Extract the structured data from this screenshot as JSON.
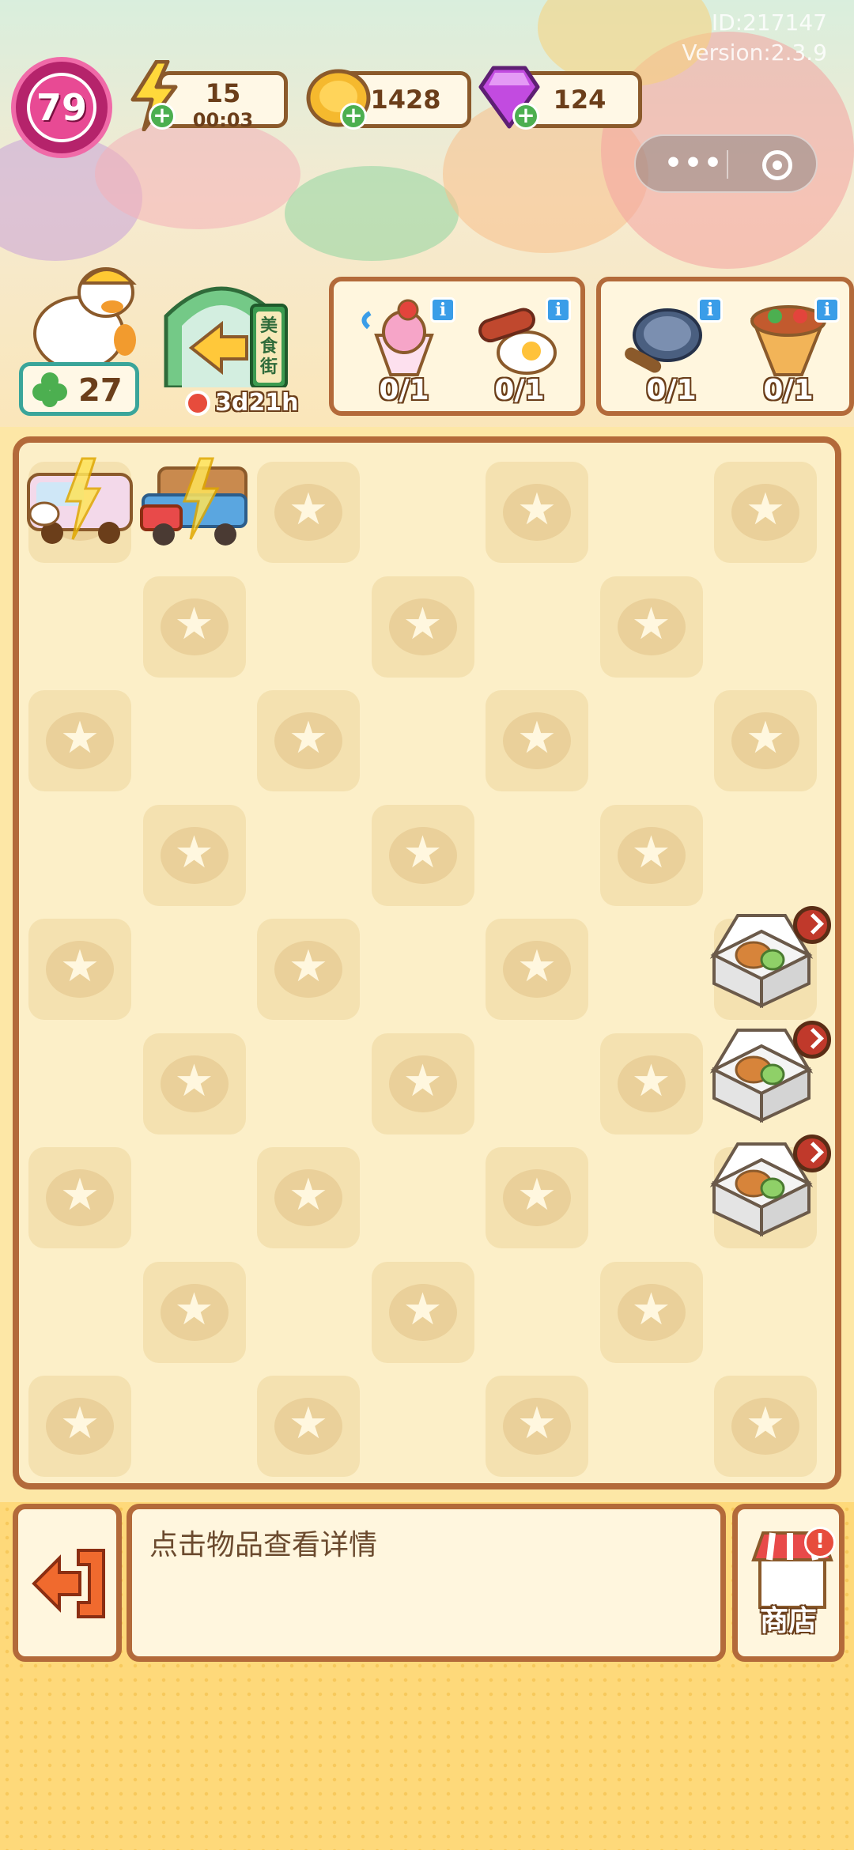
{
  "header": {
    "id_text": "ID:217147",
    "version_text": "Version:2.3.9"
  },
  "player": {
    "level": "79",
    "clover_count": "27"
  },
  "resources": {
    "energy": {
      "value": "15",
      "timer": "00:03",
      "icon": "lightning-icon"
    },
    "coins": {
      "value": "1428",
      "icon": "coin-icon"
    },
    "gems": {
      "value": "124",
      "icon": "gem-icon"
    }
  },
  "event": {
    "sign_text": "美食街",
    "timer": "3d21h"
  },
  "orders": [
    {
      "items": [
        {
          "icon": "ice-cream-dessert-icon",
          "count": "0/1"
        },
        {
          "icon": "fried-egg-sausage-icon",
          "count": "0/1"
        }
      ]
    },
    {
      "items": [
        {
          "icon": "frying-pan-icon",
          "count": "0/1"
        },
        {
          "icon": "wrap-roll-icon",
          "count": "0/1"
        }
      ]
    }
  ],
  "board": {
    "columns": 7,
    "rows": 9,
    "star_pattern": [
      [
        1,
        0,
        1,
        0,
        1,
        0,
        1
      ],
      [
        0,
        1,
        0,
        1,
        0,
        1,
        0
      ],
      [
        1,
        0,
        1,
        0,
        1,
        0,
        1
      ],
      [
        0,
        1,
        0,
        1,
        0,
        1,
        0
      ],
      [
        1,
        0,
        1,
        0,
        1,
        0,
        1
      ],
      [
        0,
        1,
        0,
        1,
        0,
        1,
        0
      ],
      [
        1,
        0,
        1,
        0,
        1,
        0,
        1
      ],
      [
        0,
        1,
        0,
        1,
        0,
        1,
        0
      ],
      [
        1,
        0,
        1,
        0,
        1,
        0,
        1
      ]
    ],
    "items": [
      {
        "name": "ice-cream-truck",
        "row": 0,
        "col": 0
      },
      {
        "name": "delivery-truck",
        "row": 0,
        "col": 1
      },
      {
        "name": "food-box",
        "row": 4,
        "col": 6,
        "timer": true
      },
      {
        "name": "food-box",
        "row": 5,
        "col": 6,
        "timer": true
      },
      {
        "name": "food-box",
        "row": 6,
        "col": 6,
        "timer": true
      }
    ]
  },
  "bottom": {
    "info_text": "点击物品查看详情",
    "shop_label": "商店",
    "shop_alert": "!"
  },
  "colors": {
    "frame": "#b36a3a",
    "panel": "#fff6de",
    "level": "#e84a94",
    "accent_green": "#4caf50"
  }
}
